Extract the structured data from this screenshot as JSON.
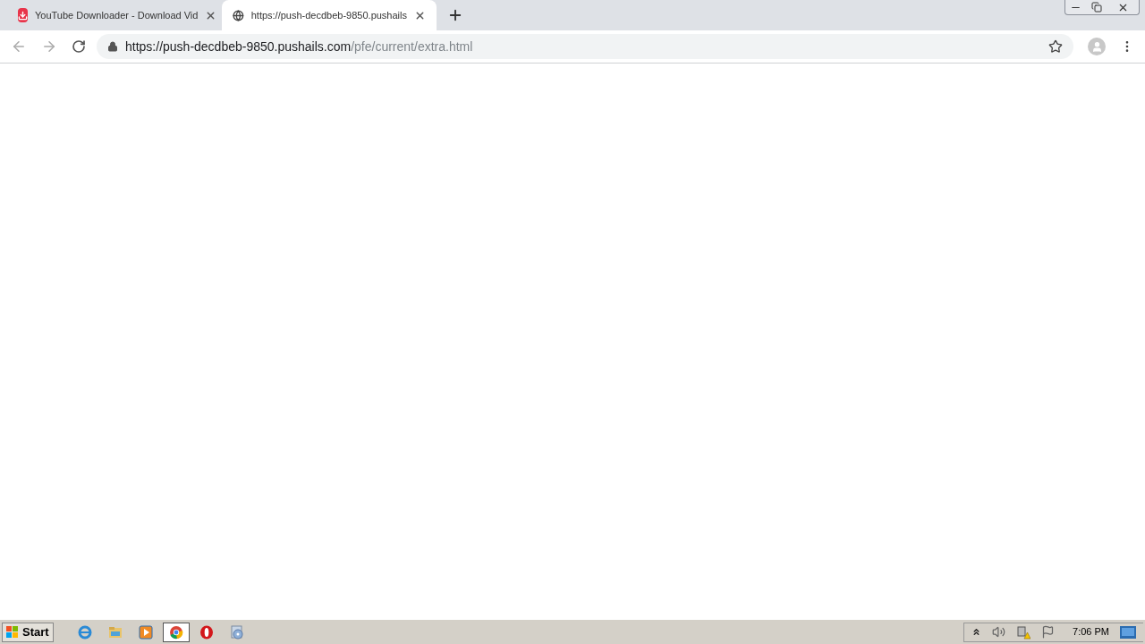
{
  "tabs": [
    {
      "title": "YouTube Downloader - Download Vid",
      "kind": "download",
      "selected": false
    },
    {
      "title": "https://push-decdbeb-9850.pushails",
      "kind": "globe",
      "selected": true
    }
  ],
  "address_bar": {
    "host": "https://push-decdbeb-9850.pushails.com",
    "path": "/pfe/current/extra.html"
  },
  "taskbar": {
    "start": "Start",
    "apps": [
      {
        "kind": "ie",
        "selected": false
      },
      {
        "kind": "folder",
        "selected": false
      },
      {
        "kind": "media",
        "selected": false
      },
      {
        "kind": "chrome",
        "selected": true
      },
      {
        "kind": "opera",
        "selected": false
      },
      {
        "kind": "setup",
        "selected": false
      }
    ],
    "clock": "7:06 PM"
  }
}
